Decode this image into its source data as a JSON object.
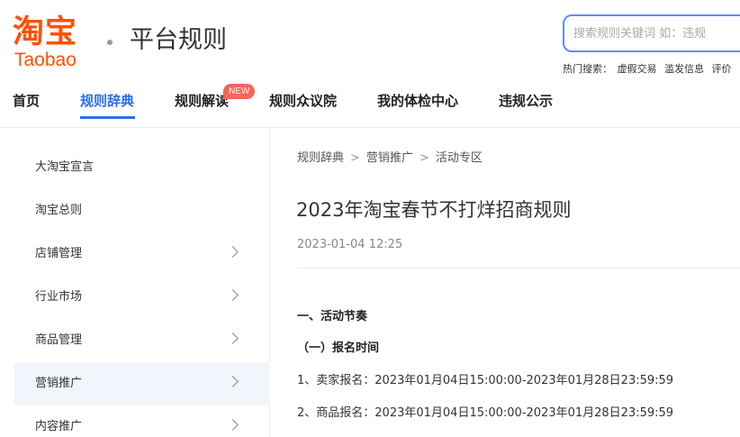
{
  "header": {
    "logo_cn": "淘宝",
    "logo_en": "Taobao",
    "site_title": "平台规则",
    "brand_color": "#ff5000"
  },
  "search": {
    "placeholder": "搜索规则关键词 如：违规",
    "value": "",
    "hot_label": "热门搜索：",
    "hot_terms": [
      "虚假交易",
      "滥发信息",
      "评价"
    ]
  },
  "nav": {
    "accent_color": "#2d6cf3",
    "items": [
      {
        "label": "首页"
      },
      {
        "label": "规则辞典",
        "active": true
      },
      {
        "label": "规则解读",
        "badge": "NEW"
      },
      {
        "label": "规则众议院"
      },
      {
        "label": "我的体检中心"
      },
      {
        "label": "违规公示"
      }
    ]
  },
  "sidebar": {
    "items": [
      {
        "label": "大淘宝宣言"
      },
      {
        "label": "淘宝总则"
      },
      {
        "label": "店铺管理",
        "icon": "chevron-right-icon"
      },
      {
        "label": "行业市场",
        "icon": "chevron-right-icon"
      },
      {
        "label": "商品管理",
        "icon": "chevron-right-icon"
      },
      {
        "label": "营销推广",
        "icon": "chevron-right-icon",
        "active": true
      },
      {
        "label": "内容推广",
        "icon": "chevron-right-icon"
      }
    ]
  },
  "breadcrumb": {
    "items": [
      "规则辞典",
      "营销推广",
      "活动专区"
    ],
    "separator": ">"
  },
  "article": {
    "title": "2023年淘宝春节不打烊招商规则",
    "date": "2023-01-04 12:25",
    "section1": "一、活动节奏",
    "subsection1": "（一）报名时间",
    "line1": "1、卖家报名：2023年01月04日15:00:00-2023年01月28日23:59:59",
    "line2": "2、商品报名：2023年01月04日15:00:00-2023年01月28日23:59:59"
  }
}
